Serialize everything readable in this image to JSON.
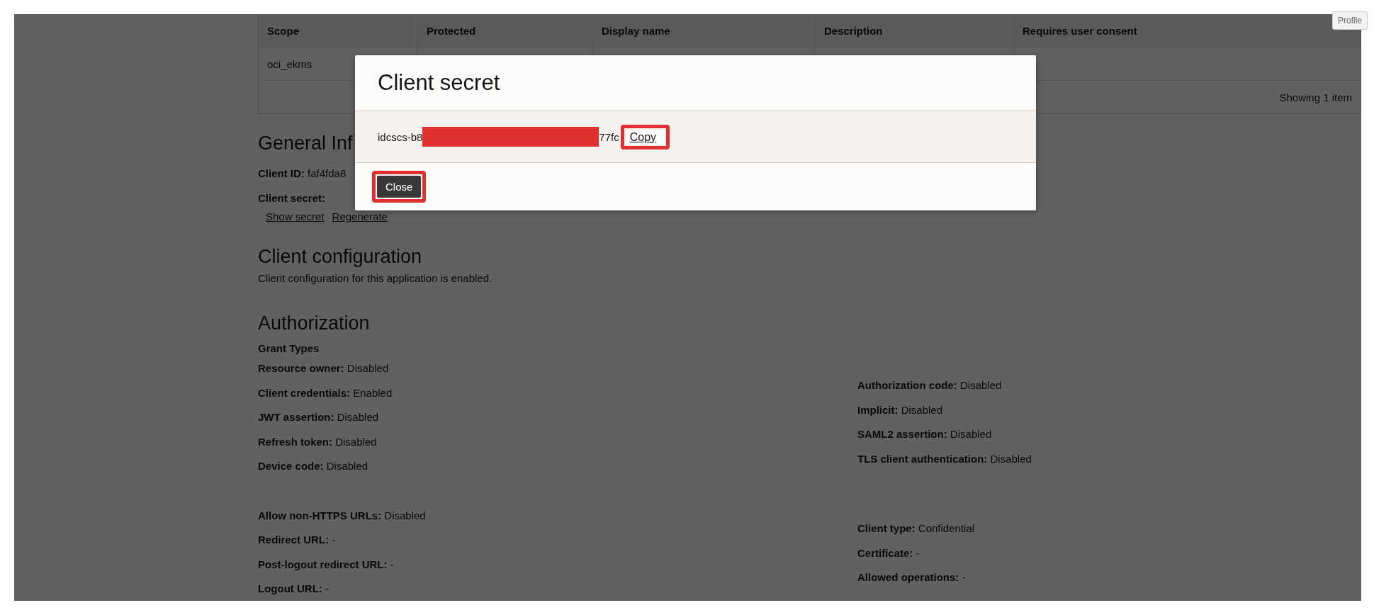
{
  "profile_button": "Profile",
  "scopes_table": {
    "columns": [
      "Scope",
      "Protected",
      "Display name",
      "Description",
      "Requires user consent"
    ],
    "rows": [
      [
        "oci_ekms"
      ]
    ],
    "footer": "Showing 1 item"
  },
  "general_info": {
    "heading": "General Inf",
    "client_id": {
      "label": "Client ID:",
      "value": "faf4fda8"
    },
    "client_secret": {
      "label": "Client secret:"
    },
    "links": [
      "Show secret",
      "Regenerate"
    ]
  },
  "client_configuration": {
    "heading": "Client configuration",
    "text": "Client configuration for this application is enabled."
  },
  "authorization": {
    "heading": "Authorization",
    "subheading": "Grant Types",
    "left": [
      "**Resource owner:** Disabled",
      "**Client credentials:** Enabled",
      "**JWT assertion:** Disabled",
      "**Refresh token:** Disabled",
      "**Device code:** Disabled"
    ],
    "left_more": [
      "**Allow non-HTTPS URLs:** Disabled",
      "**Redirect URL:** -",
      "**Post-logout redirect URL:** -",
      "**Logout URL:** -"
    ],
    "right": [
      "**Authorization code:** Disabled",
      "**Implicit:** Disabled",
      "**SAML2 assertion:** Disabled",
      "**TLS client authentication:** Disabled"
    ],
    "right_more": [
      "**Client type:** Confidential",
      "**Certificate:** -",
      "**Allowed operations:** -"
    ]
  },
  "dialog": {
    "title": "Client secret",
    "secret_start": "idcscs-b8",
    "redacted": true,
    "secret_end": "77fc",
    "copy": {
      "label": "Copy",
      "highlighted": true
    },
    "close": {
      "label": "Close",
      "highlighted": true
    }
  }
}
